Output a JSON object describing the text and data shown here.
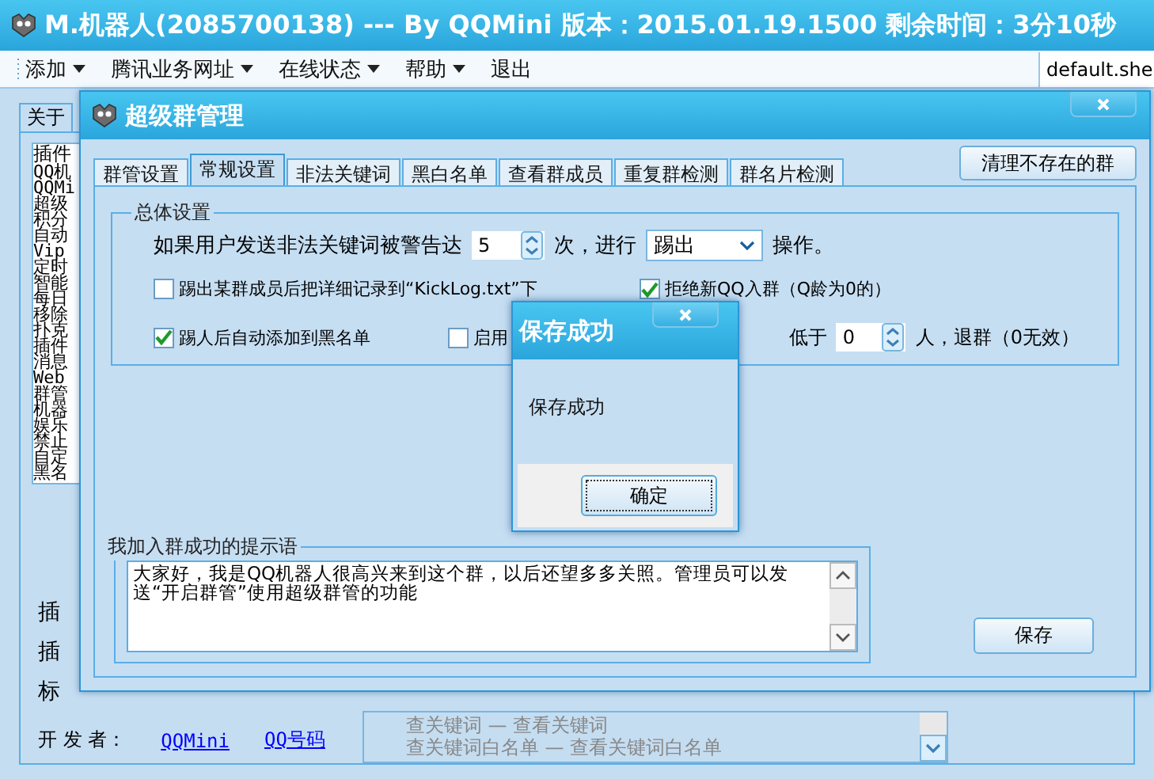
{
  "main_window": {
    "title": "M.机器人(2085700138) --- By QQMini 版本：2015.01.19.1500 剩余时间：3分10秒",
    "menu": [
      {
        "label": "添加",
        "dropdown": true
      },
      {
        "label": "腾讯业务网址",
        "dropdown": true
      },
      {
        "label": "在线状态",
        "dropdown": true
      },
      {
        "label": "帮助",
        "dropdown": true
      },
      {
        "label": "退出",
        "dropdown": false
      }
    ],
    "skin_field": {
      "value": "default.she"
    },
    "tabs": [
      {
        "label": "关于",
        "selected": true
      }
    ],
    "plugin_list": {
      "column": "插件",
      "items": [
        "QQ机",
        "QQMi",
        "超级",
        "积分",
        "自动",
        "Vip",
        "定时",
        "智能",
        "每日",
        "移除",
        "扑克",
        "插件",
        "消息",
        "Web",
        "群管",
        "机器",
        "娱乐",
        "禁止",
        "自定",
        "黑名"
      ]
    },
    "info_labels": [
      "插",
      "插",
      "标"
    ],
    "developer": {
      "label": "开 发 者：",
      "links": [
        "QQMini",
        "QQ号码"
      ]
    },
    "commands": [
      "查关键词 — 查看关键词",
      "查关键词白名单 — 查看关键词白名单"
    ]
  },
  "group_dialog": {
    "title": "超级群管理",
    "tabs": [
      {
        "label": "群管设置",
        "selected": false
      },
      {
        "label": "常规设置",
        "selected": true
      },
      {
        "label": "非法关键词",
        "selected": false
      },
      {
        "label": "黑白名单",
        "selected": false
      },
      {
        "label": "查看群成员",
        "selected": false
      },
      {
        "label": "重复群检测",
        "selected": false
      },
      {
        "label": "群名片检测",
        "selected": false
      }
    ],
    "clear_button": "清理不存在的群",
    "general": {
      "legend": "总体设置",
      "warn_prefix": "如果用户发送非法关键词被警告达",
      "warn_count": "5",
      "warn_mid": "次，进行",
      "action": "踢出",
      "warn_suffix": "操作。",
      "options": [
        {
          "label": "踢出某群成员后把详细记录到“KickLog.txt”下",
          "checked": false
        },
        {
          "label": "拒绝新QQ入群（Q龄为0的）",
          "checked": true
        },
        {
          "label": "踢人后自动添加到黑名单",
          "checked": true
        },
        {
          "label": "启用",
          "checked": false
        }
      ],
      "min_prefix": "低于",
      "min_count": "0",
      "min_suffix": "人，退群（0无效）"
    },
    "welcome": {
      "legend": "我加入群成功的提示语",
      "text": "大家好，我是QQ机器人很高兴来到这个群，以后还望多多关照。管理员可以发送“开启群管”使用超级群管的功能"
    },
    "save_button": "保存"
  },
  "message_box": {
    "title": "保存成功",
    "message": "保存成功",
    "ok_button": "确定"
  }
}
